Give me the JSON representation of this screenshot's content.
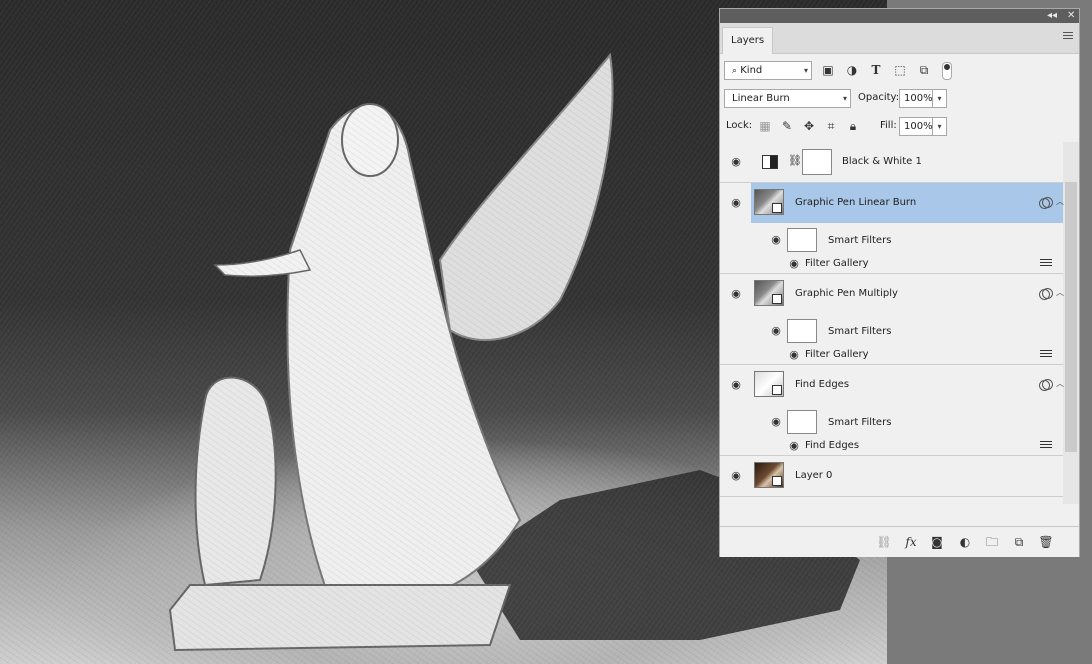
{
  "panel": {
    "title": "Layers",
    "filter": {
      "label": "Kind",
      "icons": [
        "image-filter-icon",
        "adjustment-filter-icon",
        "type-filter-icon",
        "shape-filter-icon",
        "smart-object-filter-icon"
      ]
    },
    "blend_mode": "Linear Burn",
    "opacity_label": "Opacity:",
    "opacity_value": "100%",
    "lock_label": "Lock:",
    "fill_label": "Fill:",
    "fill_value": "100%",
    "layers": [
      {
        "name": "Black & White 1",
        "type": "adjustment"
      },
      {
        "name": "Graphic Pen Linear Burn",
        "type": "smart",
        "selected": true,
        "smart_filters_label": "Smart Filters",
        "filter_name": "Filter Gallery"
      },
      {
        "name": "Graphic Pen Multiply",
        "type": "smart",
        "smart_filters_label": "Smart Filters",
        "filter_name": "Filter Gallery"
      },
      {
        "name": "Find Edges",
        "type": "smart",
        "smart_filters_label": "Smart Filters",
        "filter_name": "Find Edges"
      },
      {
        "name": "Layer 0",
        "type": "smart-photo"
      }
    ],
    "footer_icons": [
      "link-layers-icon",
      "fx-icon",
      "add-mask-icon",
      "adjustment-layer-icon",
      "new-group-icon",
      "new-layer-icon",
      "delete-icon"
    ],
    "fx_text": "fx"
  }
}
